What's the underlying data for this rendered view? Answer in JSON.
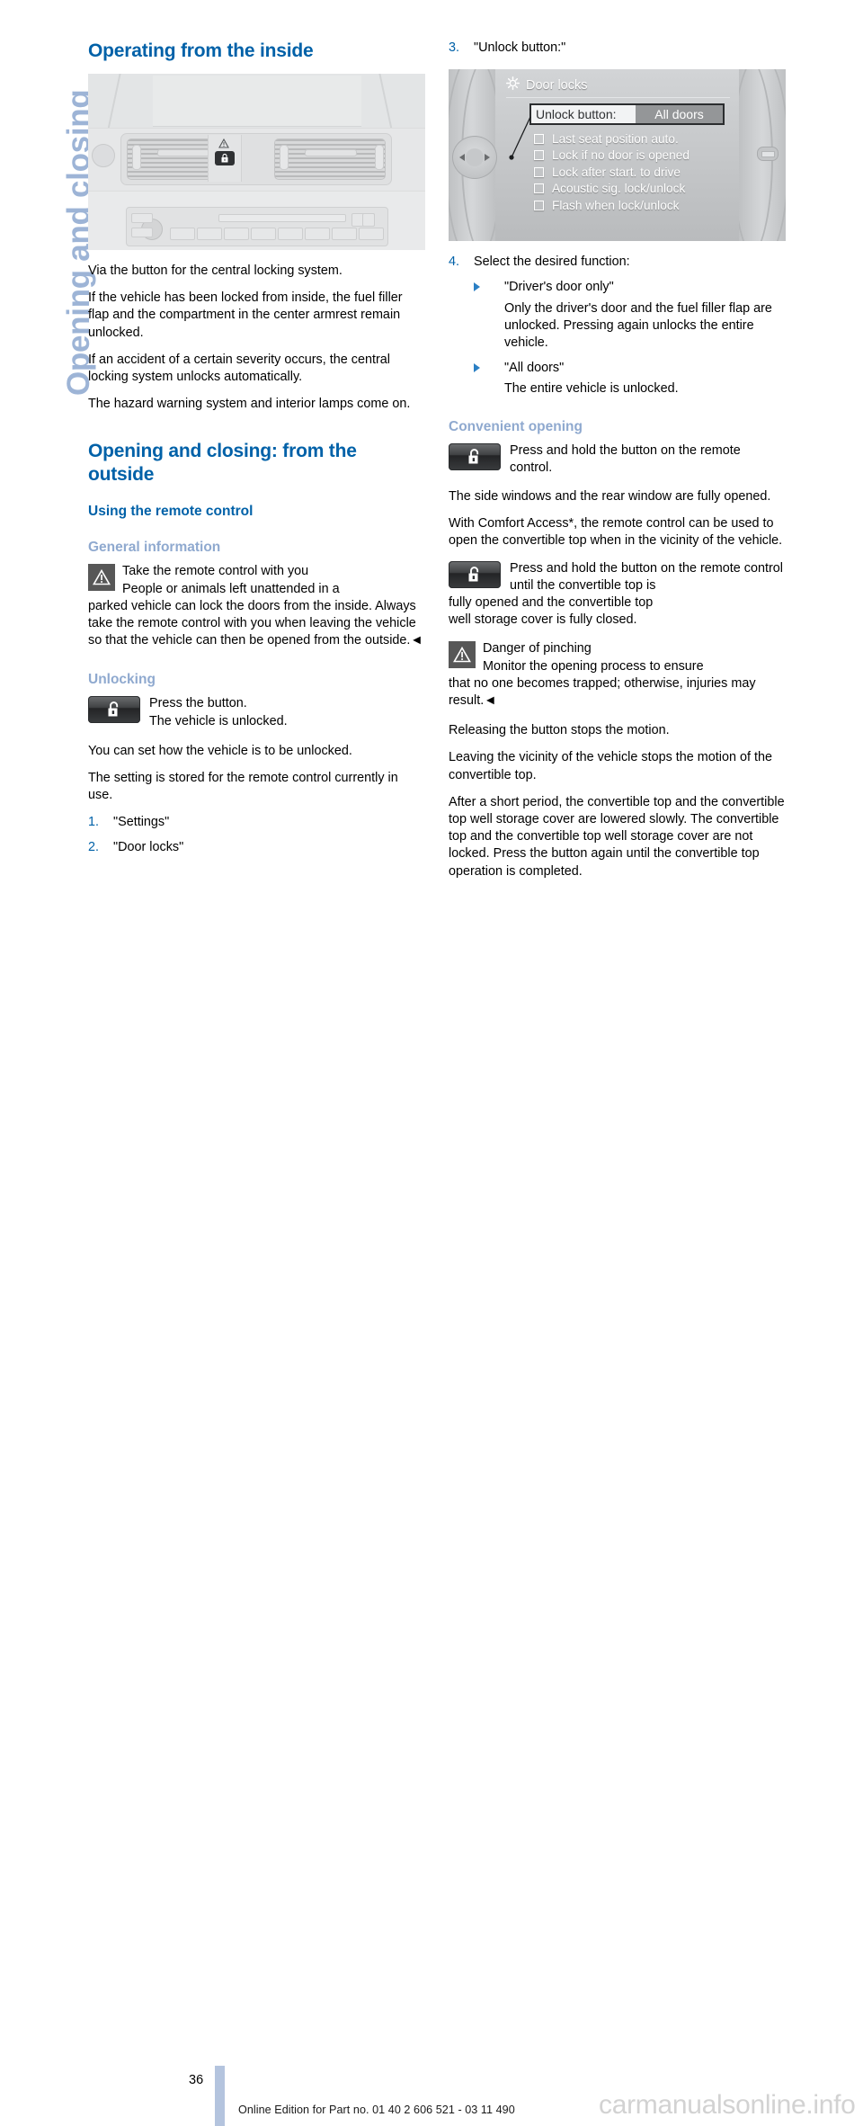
{
  "chapter_tab": {
    "label": "Opening and closing"
  },
  "left_column": {
    "heading_operating_inside": "Operating from the inside",
    "figure_dashboard_alt": "dashboard-center-console-photo",
    "para_via_button": "Via the button for the central locking system.",
    "para_locked_inside": "If the vehicle has been locked from inside, the fuel filler flap and the compartment in the center armrest remain unlocked.",
    "para_accident": "If an accident of a certain severity occurs, the central locking system unlocks automatically.",
    "para_hazard": "The hazard warning system and interior lamps come on.",
    "heading_outside": "Opening and closing: from the outside",
    "heading_remote_control": "Using the remote control",
    "heading_general_information": "General information",
    "warning_take_remote_title": "Take the remote control with you",
    "warning_take_remote_body": "People or animals left unattended in a",
    "warning_take_remote_rest": "parked vehicle can lock the doors from the inside. Always take the remote control with you when leaving the vehicle so that the vehicle can then be opened from the outside.◄",
    "heading_unlocking": "Unlocking",
    "unlock_press_button": "Press the button.",
    "unlock_vehicle_unlocked": "The vehicle is unlocked.",
    "para_you_can_set": "You can set how the vehicle is to be unlocked.",
    "para_setting_stored": "The setting is stored for the remote control currently in use.",
    "steps": [
      {
        "number": "1.",
        "text": "\"Settings\""
      },
      {
        "number": "2.",
        "text": "\"Door locks\""
      }
    ]
  },
  "right_column": {
    "step3": {
      "number": "3.",
      "text": "\"Unlock button:\""
    },
    "idrive_screen": {
      "menu_icon": "gear-icon",
      "title": "Door locks",
      "selected_row": {
        "label": "Unlock button:",
        "value": "All doors"
      },
      "options": [
        "Last seat position auto.",
        "Lock if no door is opened",
        "Lock after start. to drive",
        "Acoustic sig. lock/unlock",
        "Flash when lock/unlock"
      ]
    },
    "step4": {
      "number": "4.",
      "text": "Select the desired function:"
    },
    "sub_options": [
      {
        "label": "\"Driver's door only\"",
        "body": "Only the driver's door and the fuel filler flap are unlocked. Pressing again unlocks the entire vehicle."
      },
      {
        "label": "\"All doors\"",
        "body": "The entire vehicle is unlocked."
      }
    ],
    "heading_convenient_opening": "Convenient opening",
    "convenient_press_hold_1": "Press and hold the button on the remote control.",
    "para_side_windows": "The side windows and the rear window are fully opened.",
    "para_comfort_access": "With Comfort Access*, the remote control can be used to open the convertible top when in the vicinity of the vehicle.",
    "convenient_press_hold_2": "Press and hold the button on the remote control until the convertible top is",
    "convenient_press_hold_2_rest": "fully opened and the convertible top",
    "convenient_press_hold_2_rest2": "well storage cover is fully closed.",
    "warning_pinching_title": "Danger of pinching",
    "warning_pinching_body": "Monitor the opening process to ensure",
    "warning_pinching_rest": "that no one becomes trapped; otherwise, injuries may result.◄",
    "para_releasing": "Releasing the button stops the motion.",
    "para_leaving_vicinity": "Leaving the vicinity of the vehicle stops the motion of the convertible top.",
    "para_after_short_period": "After a short period, the convertible top and the convertible top well storage cover are lowered slowly. The convertible top and the convertible top well storage cover are not locked. Press the button again until the convertible top operation is completed."
  },
  "footer": {
    "page_number": "36",
    "edition_line": "Online Edition for Part no. 01 40 2 606 521 - 03 11 490",
    "watermark": "carmanualsonline.info"
  },
  "colors": {
    "heading_blue": "#0061a8",
    "subheading_light_blue": "#8fa9cf",
    "tab_blue": "#9db4d6",
    "page_bar_blue": "#b4c4de",
    "bullet_blue": "#2b7fc4",
    "watermark_gray": "#d2d2d2"
  }
}
